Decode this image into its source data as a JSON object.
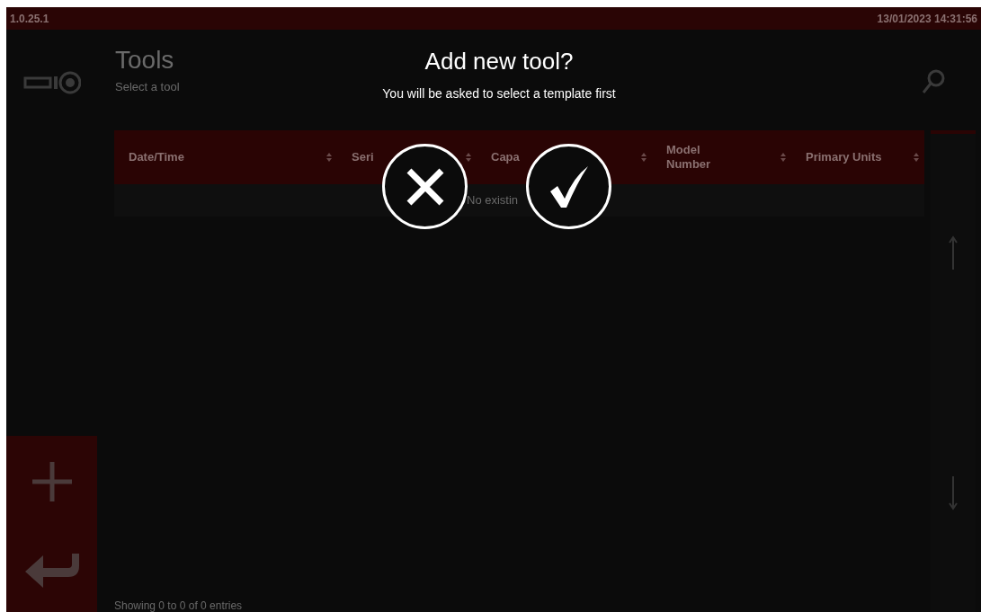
{
  "status_bar": {
    "version": "1.0.25.1",
    "datetime": "13/01/2023 14:31:56"
  },
  "page": {
    "title": "Tools",
    "subtitle": "Select a tool"
  },
  "table": {
    "columns": [
      {
        "label": "Date/Time"
      },
      {
        "label": "Seri"
      },
      {
        "label": "Capa"
      },
      {
        "label": "Model Number"
      },
      {
        "label": "Primary Units"
      }
    ],
    "empty_message": "No existin",
    "footer": "Showing 0 to 0 of 0 entries"
  },
  "dialog": {
    "title": "Add new tool?",
    "message": "You will be asked to select a template first"
  }
}
